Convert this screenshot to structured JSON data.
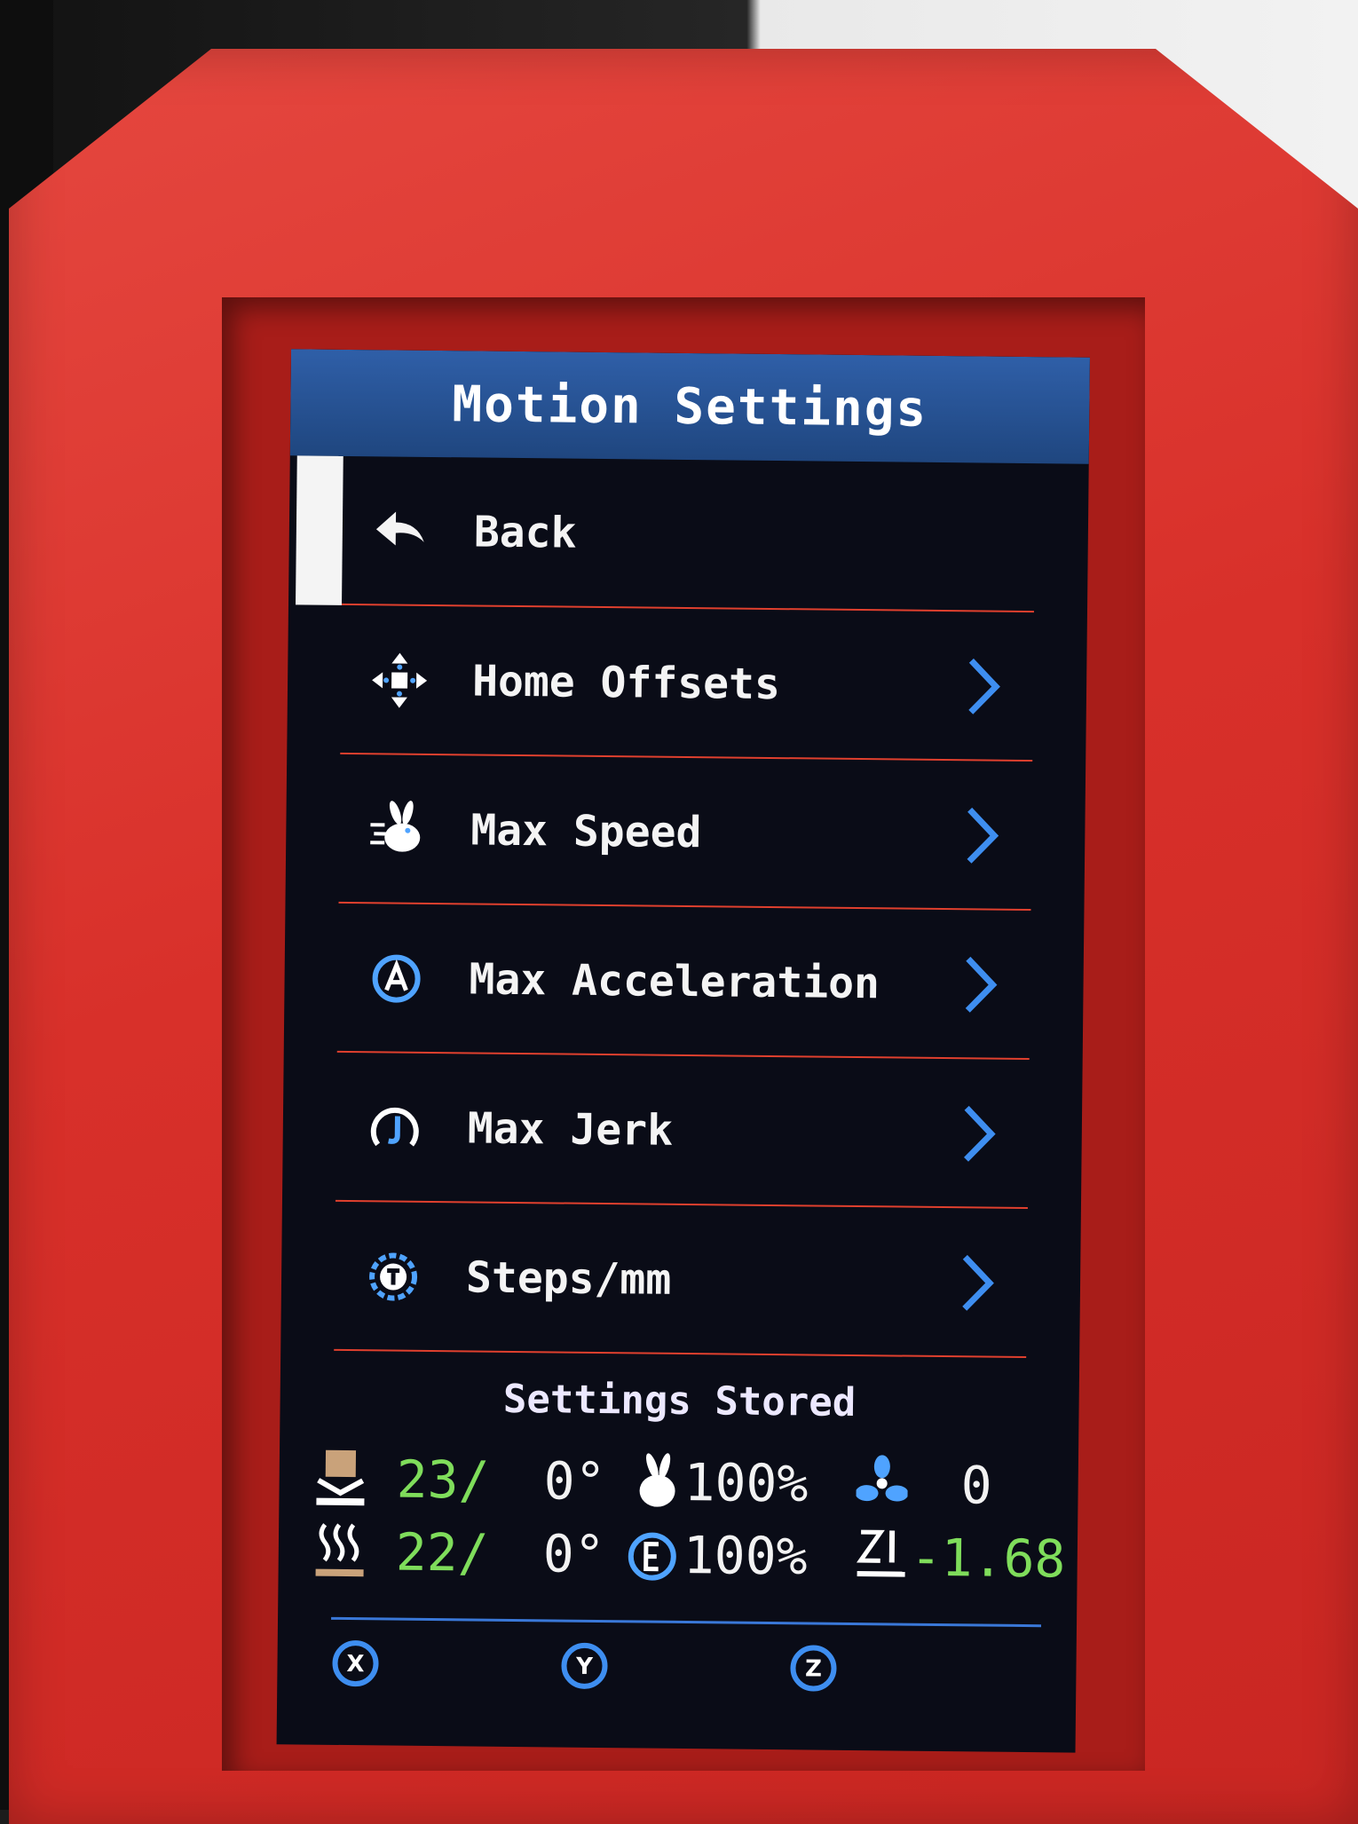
{
  "title": "Motion Settings",
  "menu": [
    {
      "label": "Back",
      "icon": "back-arrow-icon",
      "chevron": false,
      "selected": true
    },
    {
      "label": "Home Offsets",
      "icon": "move-axes-icon",
      "chevron": true
    },
    {
      "label": "Max Speed",
      "icon": "rabbit-speed-icon",
      "chevron": true
    },
    {
      "label": "Max Acceleration",
      "icon": "acceleration-icon",
      "chevron": true
    },
    {
      "label": "Max Jerk",
      "icon": "jerk-icon",
      "chevron": true
    },
    {
      "label": "Steps/mm",
      "icon": "steps-icon",
      "chevron": true
    }
  ],
  "status_message": "Settings Stored",
  "status": {
    "bed_current": "23",
    "bed_target": "0°",
    "feedrate": "100%",
    "fan": "0",
    "hotend_current": "22",
    "hotend_target": "0°",
    "flow": "100%",
    "z_offset": "-1.68"
  },
  "axes": [
    "X",
    "Y",
    "Z"
  ],
  "colors": {
    "title_bar": "#2f5fa8",
    "divider": "#e0402e",
    "accent_blue": "#3a78d8",
    "temp_green": "#7fdd5b",
    "case_red": "#d8302a"
  }
}
